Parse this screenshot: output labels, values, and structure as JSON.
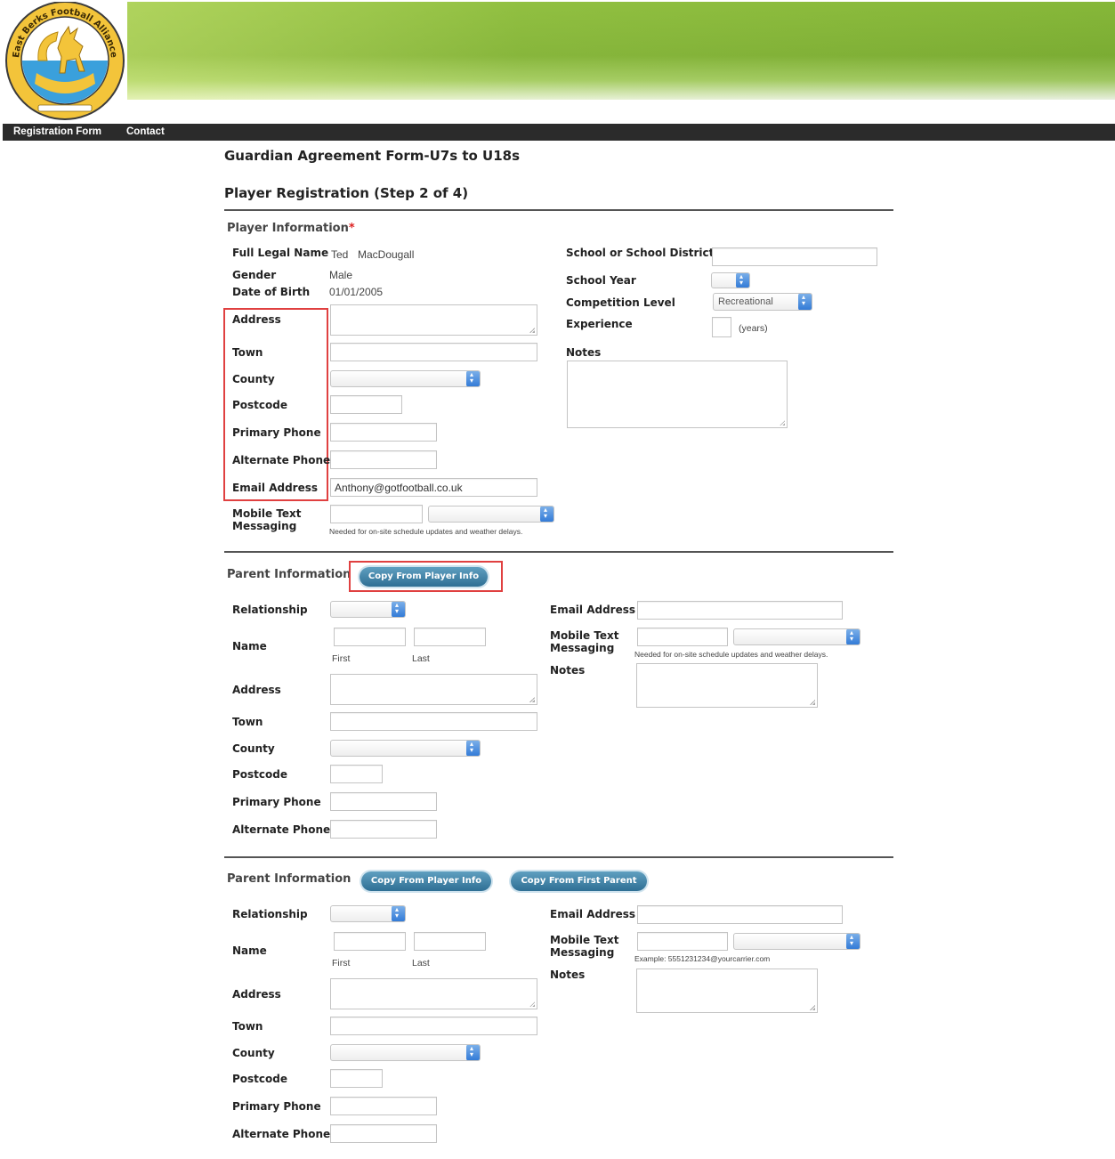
{
  "header": {
    "logo_text": "East Berks Football Alliance",
    "nav": [
      "Registration Form",
      "Contact"
    ]
  },
  "page": {
    "form_title": "Guardian Agreement Form-U7s to U18s",
    "step_title": "Player Registration (Step 2 of 4)"
  },
  "player": {
    "section_title": "Player Information",
    "required_mark": "*",
    "labels": {
      "full_legal_name": "Full Legal Name",
      "gender": "Gender",
      "dob": "Date of Birth",
      "address": "Address",
      "town": "Town",
      "county": "County",
      "postcode": "Postcode",
      "primary_phone": "Primary Phone",
      "alternate_phone": "Alternate Phone",
      "email": "Email Address",
      "mobile_text": "Mobile Text Messaging",
      "school": "School or School District",
      "school_year": "School Year",
      "competition_level": "Competition Level",
      "experience": "Experience",
      "notes": "Notes"
    },
    "values": {
      "first_name": "Ted",
      "last_name": "MacDougall",
      "gender": "Male",
      "dob": "01/01/2005",
      "email": "Anthony@gotfootball.co.uk",
      "competition_level": "Recreational",
      "experience_unit": "(years)"
    },
    "mobile_hint": "Needed for on-site schedule updates and weather delays."
  },
  "parent1": {
    "section_title": "Parent Information",
    "copy_player_button": "Copy From Player Info",
    "labels": {
      "relationship": "Relationship",
      "name": "Name",
      "first": "First",
      "last": "Last",
      "address": "Address",
      "town": "Town",
      "county": "County",
      "postcode": "Postcode",
      "primary_phone": "Primary Phone",
      "alternate_phone": "Alternate Phone",
      "email": "Email Address",
      "mobile_text": "Mobile Text Messaging",
      "notes": "Notes"
    },
    "mobile_hint": "Needed for on-site schedule updates and weather delays."
  },
  "parent2": {
    "section_title": "Parent Information",
    "copy_player_button": "Copy From Player Info",
    "copy_parent_button": "Copy From First Parent",
    "labels": {
      "relationship": "Relationship",
      "name": "Name",
      "first": "First",
      "last": "Last",
      "address": "Address",
      "town": "Town",
      "county": "County",
      "postcode": "Postcode",
      "primary_phone": "Primary Phone",
      "alternate_phone": "Alternate Phone",
      "email": "Email Address",
      "mobile_text": "Mobile Text Messaging",
      "notes": "Notes"
    },
    "mobile_hint": "Example: 5551231234@yourcarrier.com"
  },
  "colors": {
    "banner_green": "#8cbd3c",
    "nav_bg": "#2b2b2b",
    "button_blue": "#3d7fa3",
    "select_arrow_blue": "#2f78d6",
    "highlight_red": "#e04040"
  }
}
